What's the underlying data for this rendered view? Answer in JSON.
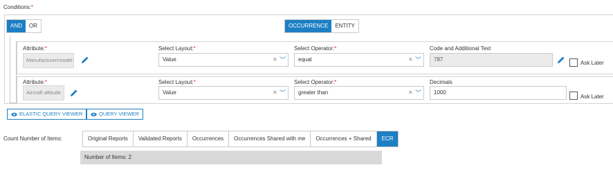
{
  "conditions": {
    "label": "Conditions:",
    "required_mark": "*"
  },
  "logic_toggle": {
    "and": "AND",
    "or": "OR",
    "selected": "AND"
  },
  "type_toggle": {
    "occurrence": "OCCURRENCE",
    "entity": "ENTITY",
    "selected": "OCCURRENCE"
  },
  "rows": [
    {
      "attribute_label": "Attribute:",
      "attribute_value": "Manufacturer/model",
      "layout_label": "Select Layout:",
      "layout_value": "Value",
      "operator_label": "Select Operator:",
      "operator_value": "equal",
      "extra_label": "Code and Additional Text",
      "extra_value": "787",
      "ask_later": "Ask Later"
    },
    {
      "attribute_label": "Attribute:",
      "attribute_value": "Aircraft altitude",
      "layout_label": "Select Layout:",
      "layout_value": "Value",
      "operator_label": "Select Operator:",
      "operator_value": "greater than",
      "extra_label": "Decimals",
      "extra_value": "1000",
      "ask_later": "Ask Later"
    }
  ],
  "viewers": {
    "elastic": "ELASTIC QUERY VIEWER",
    "query": "QUERY VIEWER"
  },
  "count": {
    "label": "Count Number of Items:",
    "tabs": [
      "Original Reports",
      "Validated Reports",
      "Occurrences",
      "Occurrences Shared with me",
      "Occurrences + Shared",
      "ECR"
    ],
    "active_tab": "ECR",
    "summary": "Number of Items: 2"
  },
  "colors": {
    "accent": "#1d7fc4",
    "required": "#d9342b",
    "summary_bg": "#d9d9d9"
  },
  "icons": {
    "edit": "pencil-icon",
    "eye": "eye-icon",
    "clear": "clear-icon",
    "dropdown": "chevron-down-icon"
  }
}
